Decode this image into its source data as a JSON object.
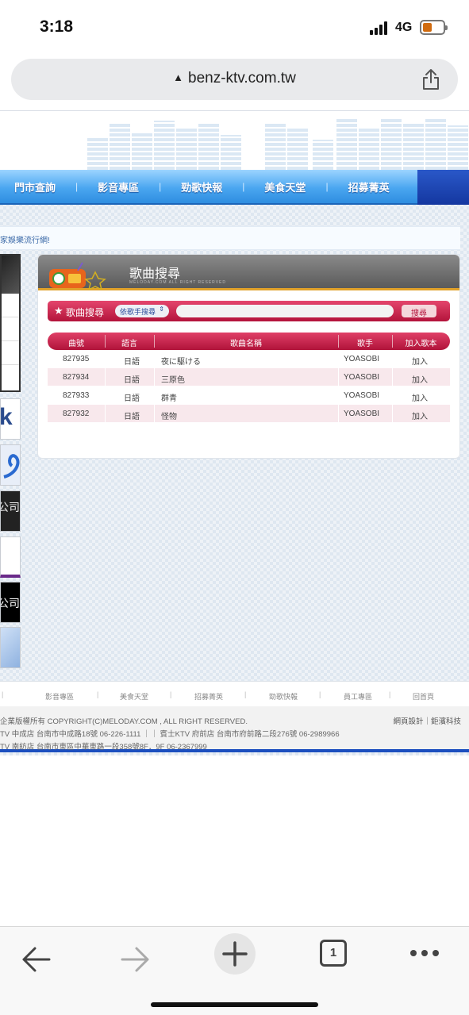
{
  "status_bar": {
    "time": "3:18",
    "network": "4G"
  },
  "browser": {
    "url": "benz-ktv.com.tw",
    "tab_count": "1"
  },
  "nav": {
    "items": [
      "門市查詢",
      "影音專區",
      "勁歌快報",
      "美食天堂",
      "招募菁英"
    ],
    "separator": "|"
  },
  "marquee": "家娛樂流行網!",
  "ads": [
    "k",
    "公司",
    "公司"
  ],
  "panel": {
    "title": "歌曲搜尋",
    "subtitle": "MELODAY.COM ALL RIGHT RESERVED",
    "search": {
      "star": "★",
      "label": "歌曲搜尋",
      "select_value": "依歌手搜尋",
      "button_label": "搜尋"
    },
    "table": {
      "headers": [
        "曲號",
        "語言",
        "歌曲名稱",
        "歌手",
        "加入歌本"
      ],
      "rows": [
        {
          "id": "827935",
          "lang": "日語",
          "title": "夜に駆ける",
          "artist": "YOASOBI",
          "action": "加入"
        },
        {
          "id": "827934",
          "lang": "日語",
          "title": "三原色",
          "artist": "YOASOBI",
          "action": "加入"
        },
        {
          "id": "827933",
          "lang": "日語",
          "title": "群青",
          "artist": "YOASOBI",
          "action": "加入"
        },
        {
          "id": "827932",
          "lang": "日語",
          "title": "怪物",
          "artist": "YOASOBI",
          "action": "加入"
        }
      ]
    }
  },
  "footer_nav": [
    "影音專區",
    "美食天堂",
    "招募菁英",
    "勁歌快報",
    "員工專區",
    "回首頁"
  ],
  "footer": {
    "line1": "企業版權所有 COPYRIGHT(C)MELODAY.COM , ALL RIGHT RESERVED.",
    "line2": "TV 中成店 台南市中成路18號 06-226-1111 ｜｜ 賓士KTV 府前店 台南市府前路二段276號 06-2989966",
    "line3": "TV 南紡店 台南市東區中華東路一段358號8F．9F 06-2367999",
    "credit": "網頁設計｜鉅濱科技"
  },
  "colors": {
    "accent": "#c8194a",
    "nav": "#4aa6f0",
    "footer_line": "#1c4fbf"
  }
}
